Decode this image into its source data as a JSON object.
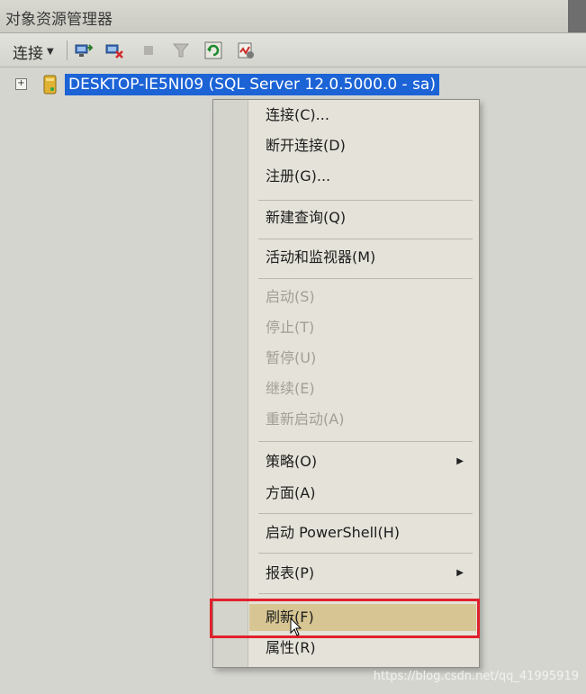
{
  "window": {
    "title": "对象资源管理器"
  },
  "toolbar": {
    "connect_label": "连接",
    "icons": [
      "connect-object-explorer-icon",
      "disconnect-icon",
      "stop-icon",
      "filter-icon",
      "refresh-icon",
      "activity-monitor-icon"
    ]
  },
  "tree": {
    "server_node": "DESKTOP-IE5NI09 (SQL Server 12.0.5000.0 - sa)",
    "expand_glyph": "+"
  },
  "context_menu": {
    "items": [
      {
        "label": "连接(C)...",
        "enabled": true
      },
      {
        "label": "断开连接(D)",
        "enabled": true
      },
      {
        "label": "注册(G)...",
        "enabled": true
      },
      {
        "label": "新建查询(Q)",
        "enabled": true
      },
      {
        "label": "活动和监视器(M)",
        "enabled": true
      },
      {
        "label": "启动(S)",
        "enabled": false
      },
      {
        "label": "停止(T)",
        "enabled": false
      },
      {
        "label": "暂停(U)",
        "enabled": false
      },
      {
        "label": "继续(E)",
        "enabled": false
      },
      {
        "label": "重新启动(A)",
        "enabled": false
      },
      {
        "label": "策略(O)",
        "enabled": true,
        "submenu": true
      },
      {
        "label": "方面(A)",
        "enabled": true
      },
      {
        "label": "启动 PowerShell(H)",
        "enabled": true
      },
      {
        "label": "报表(P)",
        "enabled": true,
        "submenu": true
      },
      {
        "label": "刷新(F)",
        "enabled": true,
        "highlighted": true
      },
      {
        "label": "属性(R)",
        "enabled": true
      }
    ]
  },
  "annotation": {
    "highlight_color": "#e0212b",
    "highlighted_item": "刷新(F)"
  },
  "watermark": "https://blog.csdn.net/qq_41995919",
  "colors": {
    "selection": "#1c63d6",
    "menu_highlight": "#d7c693"
  }
}
